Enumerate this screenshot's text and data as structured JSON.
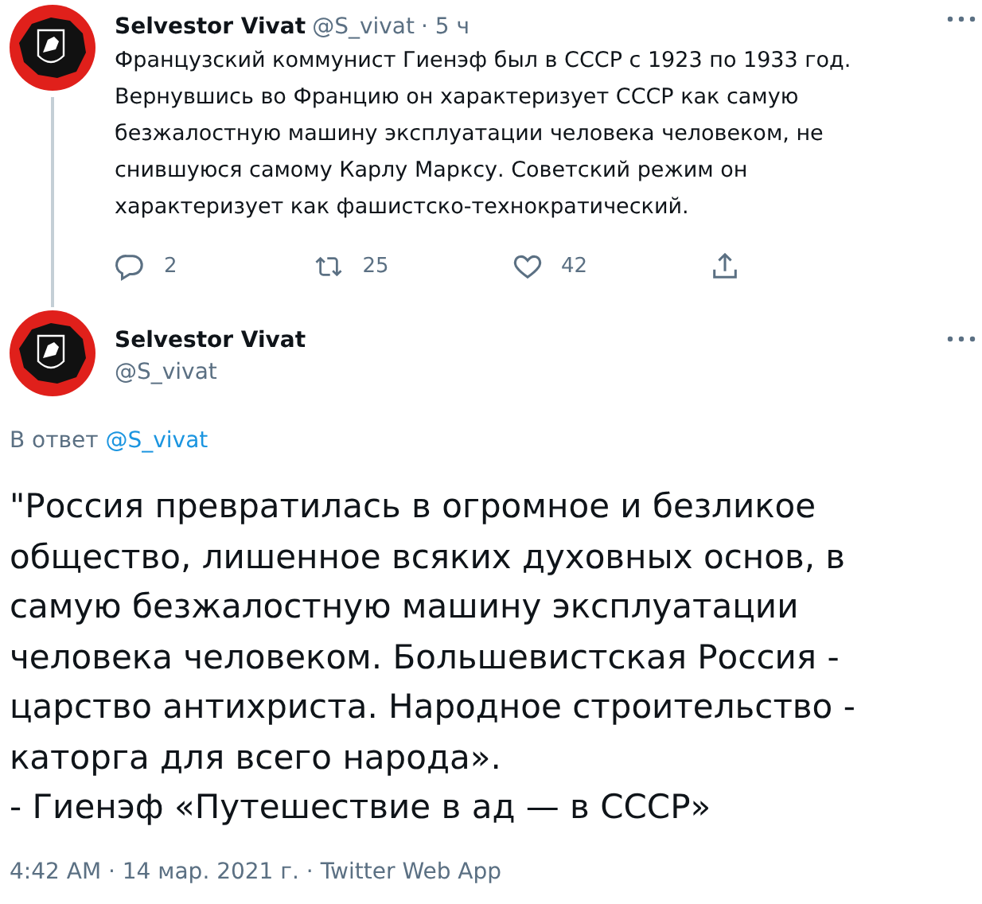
{
  "tweet": {
    "name": "Selvestor Vivat",
    "handle": "@S_vivat",
    "time": "· 5 ч",
    "text": "Французский коммунист Гиенэф был в СССР с 1923 по 1933 год. Вернувшись во Францию он характеризует СССР как самую безжалостную машину эксплуатации человека человеком, не снившуюся самому Карлу Марксу. Советский режим он характеризует как фашистско-технократический.",
    "actions": [
      {
        "kind": "reply",
        "count": "2"
      },
      {
        "kind": "retweet",
        "count": "25"
      },
      {
        "kind": "like",
        "count": "42"
      },
      {
        "kind": "share"
      }
    ]
  },
  "reply": {
    "name": "Selvestor Vivat",
    "handle": "@S_vivat",
    "reply_to_label": "В ответ",
    "reply_to_handle": "@S_vivat",
    "text": "\"Россия превратилась в огромное и безликое общество, лишенное всяких духовных основ, в самую безжалостную машину эксплуатации человека человеком. Большевистская Россия - царство антихриста. Народное строительство - каторга для всего народа».\n- Гиенэф «Путешествие в ад — в СССР»",
    "meta": "4:42 AM · 14 мар. 2021 г. · Twitter Web App"
  }
}
